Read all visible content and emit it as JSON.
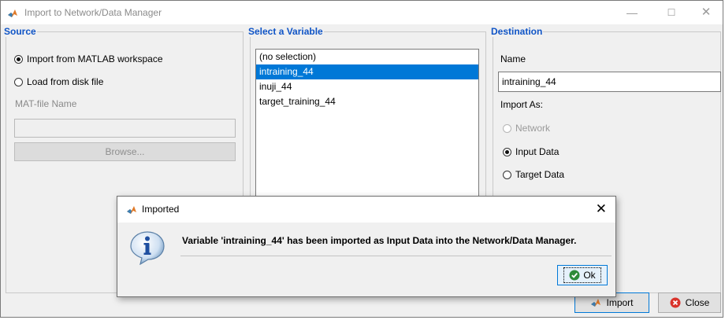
{
  "window": {
    "title": "Import to Network/Data Manager"
  },
  "source": {
    "legend": "Source",
    "option_workspace": "Import from MATLAB workspace",
    "option_disk": "Load from disk file",
    "mat_label": "MAT-file Name",
    "mat_value": "",
    "browse_label": "Browse..."
  },
  "variable": {
    "legend": "Select a Variable",
    "items": [
      "(no selection)",
      "intraining_44",
      "inuji_44",
      "target_training_44"
    ],
    "selected": "intraining_44"
  },
  "destination": {
    "legend": "Destination",
    "name_label": "Name",
    "name_value": "intraining_44",
    "import_as_label": "Import As:",
    "opt_network": "Network",
    "opt_input": "Input Data",
    "opt_target": "Target Data"
  },
  "buttons": {
    "import": "Import",
    "close": "Close"
  },
  "dialog": {
    "title": "Imported",
    "message": "Variable 'intraining_44' has been imported as Input Data into the Network/Data Manager.",
    "ok": "Ok"
  },
  "colors": {
    "accent": "#0078d7",
    "legend": "#0f54c6",
    "selection": "#0078d7"
  },
  "icons": [
    "matlab-logo-icon",
    "minimize-icon",
    "maximize-icon",
    "close-icon",
    "info-icon",
    "check-icon",
    "error-icon"
  ]
}
